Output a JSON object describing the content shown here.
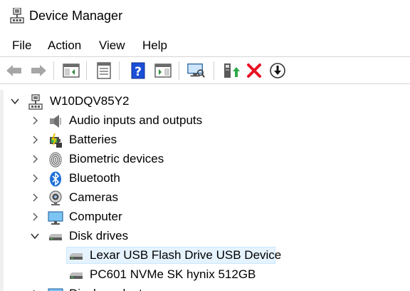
{
  "window": {
    "title": "Device Manager"
  },
  "menu": {
    "items": [
      "File",
      "Action",
      "View",
      "Help"
    ]
  },
  "toolbar": {
    "buttons": [
      {
        "icon": "back-arrow-icon"
      },
      {
        "icon": "forward-arrow-icon"
      },
      {
        "icon": "show-hide-console-tree-icon"
      },
      {
        "icon": "properties-icon"
      },
      {
        "icon": "help-icon"
      },
      {
        "icon": "action-pane-icon"
      },
      {
        "icon": "scan-hardware-icon"
      },
      {
        "icon": "update-driver-icon"
      },
      {
        "icon": "uninstall-device-icon"
      },
      {
        "icon": "disable-device-icon"
      }
    ]
  },
  "tree": {
    "root": "W10DQV85Y2",
    "categories": [
      {
        "label": "Audio inputs and outputs",
        "icon": "speaker-icon",
        "expanded": false
      },
      {
        "label": "Batteries",
        "icon": "battery-icon",
        "expanded": false
      },
      {
        "label": "Biometric devices",
        "icon": "fingerprint-icon",
        "expanded": false
      },
      {
        "label": "Bluetooth",
        "icon": "bluetooth-icon",
        "expanded": false
      },
      {
        "label": "Cameras",
        "icon": "camera-icon",
        "expanded": false
      },
      {
        "label": "Computer",
        "icon": "monitor-icon",
        "expanded": false
      },
      {
        "label": "Disk drives",
        "icon": "disk-drive-icon",
        "expanded": true
      }
    ],
    "disk_drives": [
      {
        "label": "Lexar USB Flash Drive USB Device",
        "selected": true
      },
      {
        "label": "PC601 NVMe SK hynix 512GB",
        "selected": false
      }
    ],
    "next_category_partial": "Display adapters"
  },
  "colors": {
    "selection_bg": "#e5f3ff",
    "selection_border": "#cce8ff",
    "help_blue": "#1b4fd8",
    "uninstall_red": "#e81123",
    "update_green": "#2ea84a"
  }
}
